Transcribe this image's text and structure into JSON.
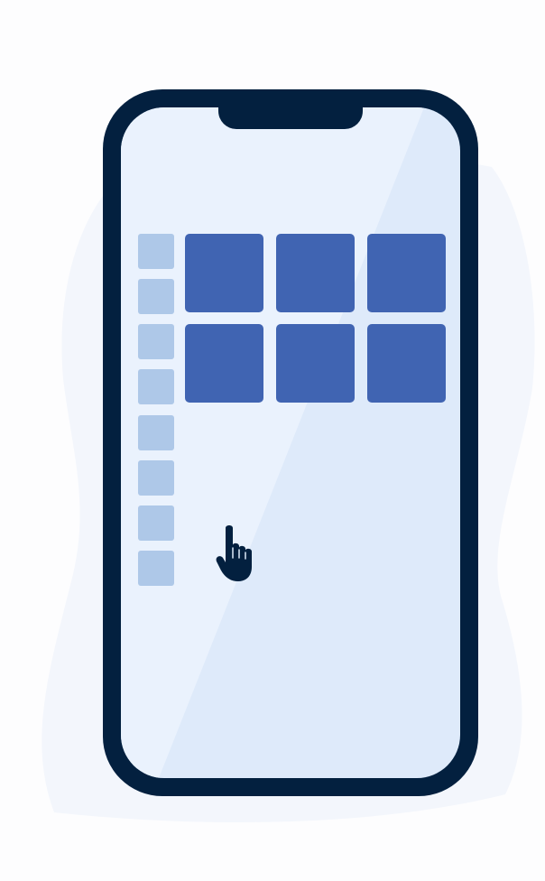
{
  "illustration": {
    "cursor_icon": "hand-pointer-icon",
    "sidebar_tile_count": 8,
    "grid_rows": 2,
    "grid_columns": 3
  },
  "colors": {
    "phone_frame": "#03203f",
    "screen": "#deeafa",
    "sidebar_tile": "#aec8e8",
    "grid_tile": "#4064b2",
    "background_blob": "#f3f6fc"
  }
}
